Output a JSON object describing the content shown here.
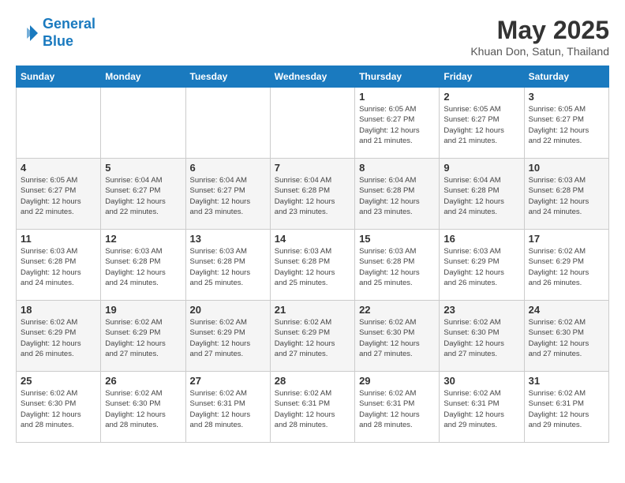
{
  "header": {
    "logo_line1": "General",
    "logo_line2": "Blue",
    "month": "May 2025",
    "location": "Khuan Don, Satun, Thailand"
  },
  "weekdays": [
    "Sunday",
    "Monday",
    "Tuesday",
    "Wednesday",
    "Thursday",
    "Friday",
    "Saturday"
  ],
  "weeks": [
    [
      {
        "day": "",
        "detail": ""
      },
      {
        "day": "",
        "detail": ""
      },
      {
        "day": "",
        "detail": ""
      },
      {
        "day": "",
        "detail": ""
      },
      {
        "day": "1",
        "detail": "Sunrise: 6:05 AM\nSunset: 6:27 PM\nDaylight: 12 hours\nand 21 minutes."
      },
      {
        "day": "2",
        "detail": "Sunrise: 6:05 AM\nSunset: 6:27 PM\nDaylight: 12 hours\nand 21 minutes."
      },
      {
        "day": "3",
        "detail": "Sunrise: 6:05 AM\nSunset: 6:27 PM\nDaylight: 12 hours\nand 22 minutes."
      }
    ],
    [
      {
        "day": "4",
        "detail": "Sunrise: 6:05 AM\nSunset: 6:27 PM\nDaylight: 12 hours\nand 22 minutes."
      },
      {
        "day": "5",
        "detail": "Sunrise: 6:04 AM\nSunset: 6:27 PM\nDaylight: 12 hours\nand 22 minutes."
      },
      {
        "day": "6",
        "detail": "Sunrise: 6:04 AM\nSunset: 6:27 PM\nDaylight: 12 hours\nand 23 minutes."
      },
      {
        "day": "7",
        "detail": "Sunrise: 6:04 AM\nSunset: 6:28 PM\nDaylight: 12 hours\nand 23 minutes."
      },
      {
        "day": "8",
        "detail": "Sunrise: 6:04 AM\nSunset: 6:28 PM\nDaylight: 12 hours\nand 23 minutes."
      },
      {
        "day": "9",
        "detail": "Sunrise: 6:04 AM\nSunset: 6:28 PM\nDaylight: 12 hours\nand 24 minutes."
      },
      {
        "day": "10",
        "detail": "Sunrise: 6:03 AM\nSunset: 6:28 PM\nDaylight: 12 hours\nand 24 minutes."
      }
    ],
    [
      {
        "day": "11",
        "detail": "Sunrise: 6:03 AM\nSunset: 6:28 PM\nDaylight: 12 hours\nand 24 minutes."
      },
      {
        "day": "12",
        "detail": "Sunrise: 6:03 AM\nSunset: 6:28 PM\nDaylight: 12 hours\nand 24 minutes."
      },
      {
        "day": "13",
        "detail": "Sunrise: 6:03 AM\nSunset: 6:28 PM\nDaylight: 12 hours\nand 25 minutes."
      },
      {
        "day": "14",
        "detail": "Sunrise: 6:03 AM\nSunset: 6:28 PM\nDaylight: 12 hours\nand 25 minutes."
      },
      {
        "day": "15",
        "detail": "Sunrise: 6:03 AM\nSunset: 6:28 PM\nDaylight: 12 hours\nand 25 minutes."
      },
      {
        "day": "16",
        "detail": "Sunrise: 6:03 AM\nSunset: 6:29 PM\nDaylight: 12 hours\nand 26 minutes."
      },
      {
        "day": "17",
        "detail": "Sunrise: 6:02 AM\nSunset: 6:29 PM\nDaylight: 12 hours\nand 26 minutes."
      }
    ],
    [
      {
        "day": "18",
        "detail": "Sunrise: 6:02 AM\nSunset: 6:29 PM\nDaylight: 12 hours\nand 26 minutes."
      },
      {
        "day": "19",
        "detail": "Sunrise: 6:02 AM\nSunset: 6:29 PM\nDaylight: 12 hours\nand 27 minutes."
      },
      {
        "day": "20",
        "detail": "Sunrise: 6:02 AM\nSunset: 6:29 PM\nDaylight: 12 hours\nand 27 minutes."
      },
      {
        "day": "21",
        "detail": "Sunrise: 6:02 AM\nSunset: 6:29 PM\nDaylight: 12 hours\nand 27 minutes."
      },
      {
        "day": "22",
        "detail": "Sunrise: 6:02 AM\nSunset: 6:30 PM\nDaylight: 12 hours\nand 27 minutes."
      },
      {
        "day": "23",
        "detail": "Sunrise: 6:02 AM\nSunset: 6:30 PM\nDaylight: 12 hours\nand 27 minutes."
      },
      {
        "day": "24",
        "detail": "Sunrise: 6:02 AM\nSunset: 6:30 PM\nDaylight: 12 hours\nand 27 minutes."
      }
    ],
    [
      {
        "day": "25",
        "detail": "Sunrise: 6:02 AM\nSunset: 6:30 PM\nDaylight: 12 hours\nand 28 minutes."
      },
      {
        "day": "26",
        "detail": "Sunrise: 6:02 AM\nSunset: 6:30 PM\nDaylight: 12 hours\nand 28 minutes."
      },
      {
        "day": "27",
        "detail": "Sunrise: 6:02 AM\nSunset: 6:31 PM\nDaylight: 12 hours\nand 28 minutes."
      },
      {
        "day": "28",
        "detail": "Sunrise: 6:02 AM\nSunset: 6:31 PM\nDaylight: 12 hours\nand 28 minutes."
      },
      {
        "day": "29",
        "detail": "Sunrise: 6:02 AM\nSunset: 6:31 PM\nDaylight: 12 hours\nand 28 minutes."
      },
      {
        "day": "30",
        "detail": "Sunrise: 6:02 AM\nSunset: 6:31 PM\nDaylight: 12 hours\nand 29 minutes."
      },
      {
        "day": "31",
        "detail": "Sunrise: 6:02 AM\nSunset: 6:31 PM\nDaylight: 12 hours\nand 29 minutes."
      }
    ]
  ]
}
